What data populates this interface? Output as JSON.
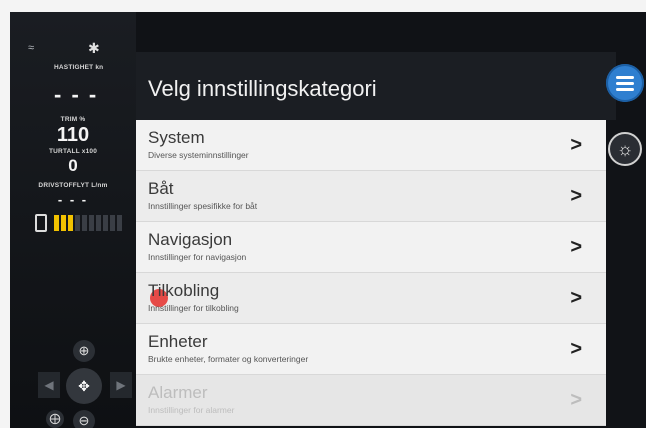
{
  "sidebar": {
    "speed_label": "HASTIGHET kn",
    "speed_value": "- - -",
    "trim_label": "TRIM %",
    "trim_value": "110",
    "rpm_label": "TURTALL x100",
    "rpm_value": "0",
    "fuel_label": "DRIVSTOFFLYT L/nm",
    "fuel_value": "- - -",
    "battery_level": 0.3,
    "battery_segments_on": 3,
    "battery_segments_total": 10
  },
  "header": {
    "title": "Velg innstillingskategori"
  },
  "categories": [
    {
      "title": "System",
      "subtitle": "Diverse systeminnstillinger",
      "chevron": ">"
    },
    {
      "title": "Båt",
      "subtitle": "Innstillinger spesifikke for båt",
      "chevron": ">"
    },
    {
      "title": "Navigasjon",
      "subtitle": "Innstillinger for navigasjon",
      "chevron": ">"
    },
    {
      "title": "Tilkobling",
      "subtitle": "Innstillinger for tilkobling",
      "chevron": ">"
    },
    {
      "title": "Enheter",
      "subtitle": "Brukte enheter, formater og konverteringer",
      "chevron": ">"
    },
    {
      "title": "Alarmer",
      "subtitle": "Innstillinger for alarmer",
      "chevron": ">"
    }
  ],
  "icons": {
    "menu": "hamburger-icon",
    "compass": "compass-icon",
    "zoom_in": "zoom-in-icon",
    "zoom_out": "zoom-out-icon",
    "pan": "pan-dpad-icon"
  },
  "colors": {
    "accent": "#2f7fd0",
    "battery_on": "#f2c200",
    "touch_dot": "#e53935"
  }
}
